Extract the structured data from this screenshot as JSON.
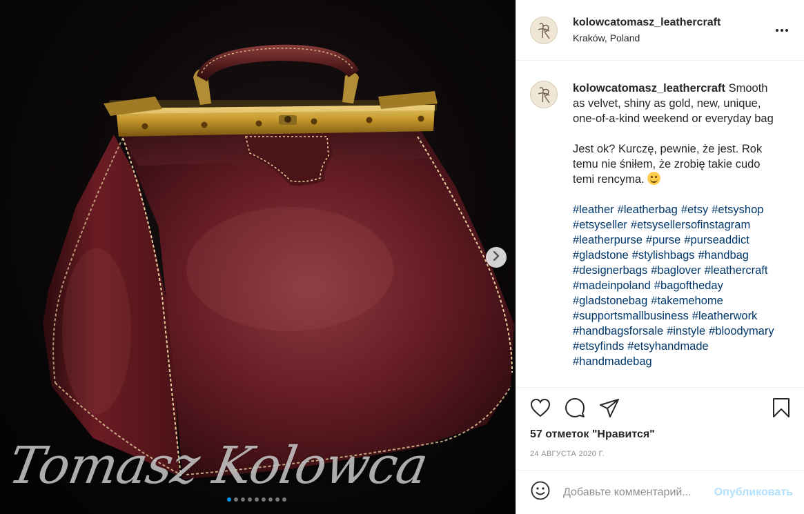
{
  "post": {
    "username": "kolowcatomasz_leathercraft",
    "location": "Kraków, Poland",
    "caption": {
      "username": "kolowcatomasz_leathercraft",
      "text": "Smooth as velvet, shiny as gold, new, unique, one-of-a-kind weekend or everyday bag",
      "text2": "Jest ok? Kurczę, pewnie, że jest. Rok temu nie śniłem, że zrobię takie cudo temi rencyma.",
      "emoji": "smiling-face-emoji",
      "hashtags": [
        "#leather",
        "#leatherbag",
        "#etsy",
        "#etsyshop",
        "#etsyseller",
        "#etsysellersofinstagram",
        "#leatherpurse",
        "#purse",
        "#purseaddict",
        "#gladstone",
        "#stylishbags",
        "#handbag",
        "#designerbags",
        "#baglover",
        "#leathercraft",
        "#madeinpoland",
        "#bagoftheday",
        "#gladstonebag",
        "#takemehome",
        "#supportsmallbusiness",
        "#leatherwork",
        "#handbagsforsale",
        "#instyle",
        "#bloodymary",
        "#etsyfinds",
        "#etsyhandmade",
        "#handmadebag"
      ]
    },
    "likes_label": "57 отметок \"Нравится\"",
    "date_label": "24 августа 2020 г.",
    "comment_placeholder": "Добавьте комментарий...",
    "publish_label": "Опубликовать",
    "watermark": "Tomasz Kolowca",
    "carousel": {
      "slide_count": 9,
      "active_index": 0
    },
    "icons": [
      "more-options-icon",
      "heart-icon",
      "comment-icon",
      "share-icon",
      "bookmark-icon",
      "emoji-icon",
      "chevron-right-icon"
    ],
    "colors": {
      "hashtag": "#00376b",
      "muted": "#8e8e8e",
      "publish": "#b2dffc",
      "active_dot": "#0095f6"
    }
  }
}
